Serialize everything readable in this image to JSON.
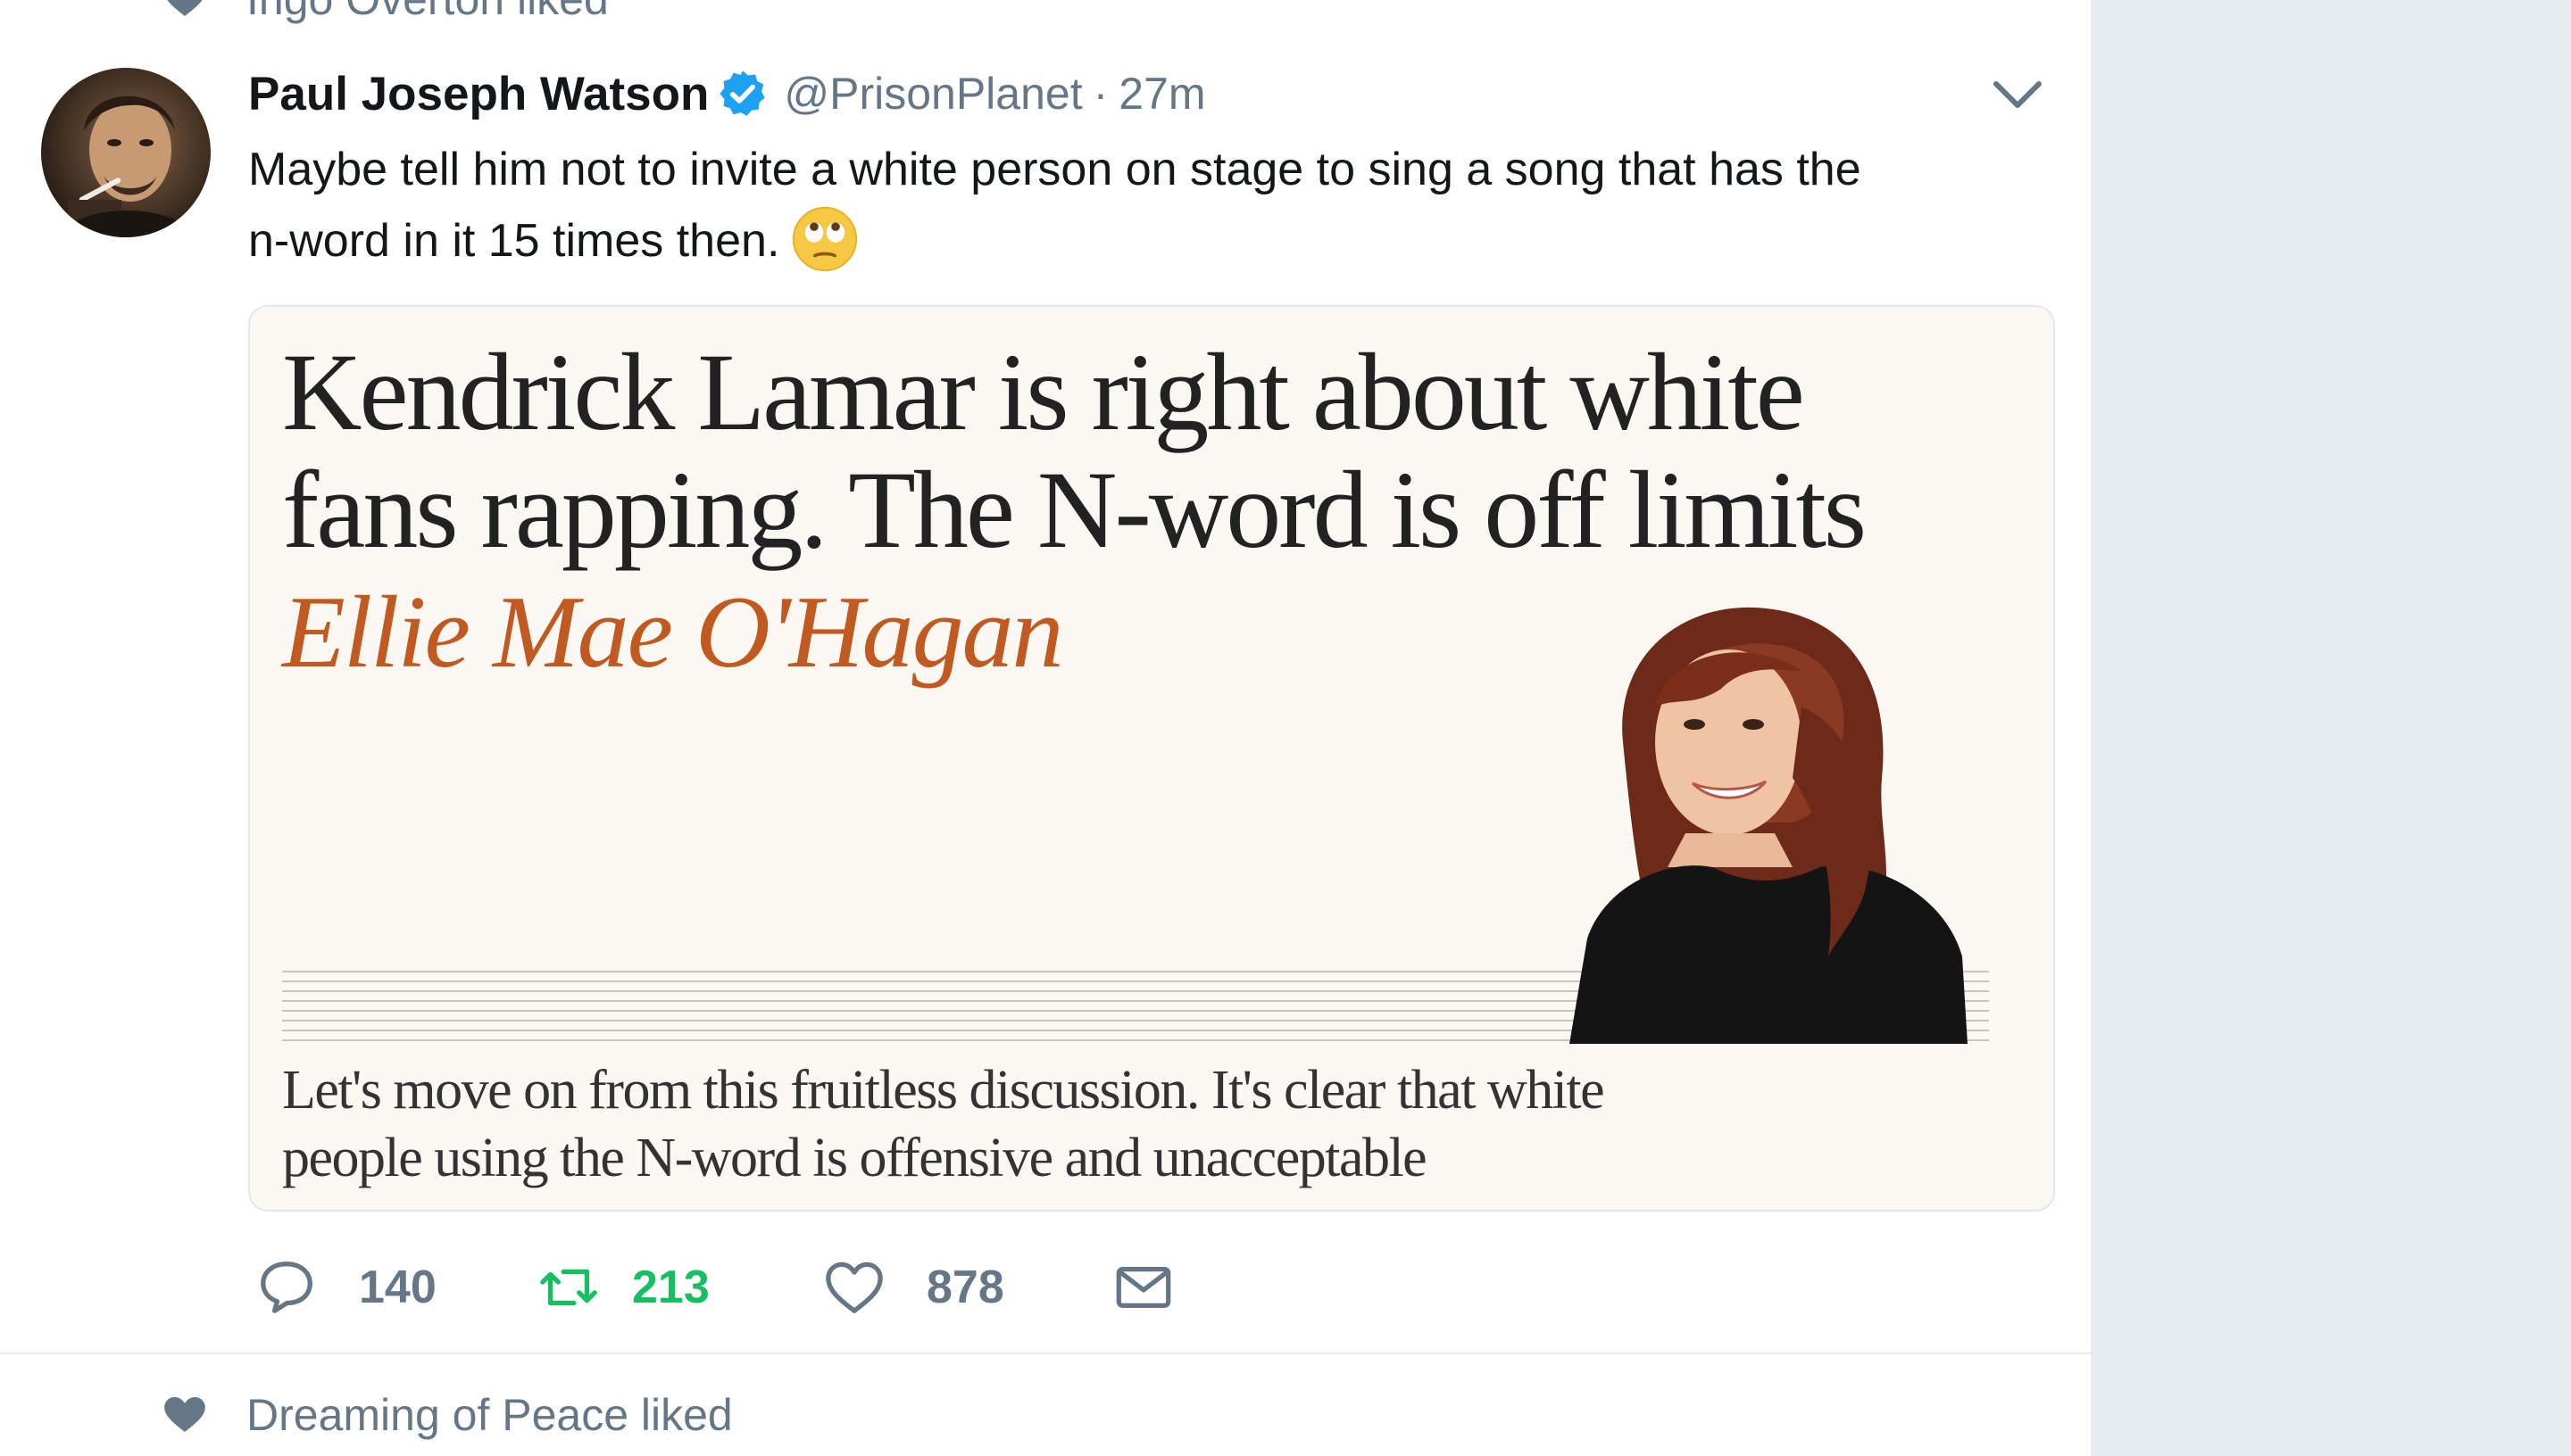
{
  "context_top": {
    "text": "Ingo Overton liked",
    "icon": "heart-icon"
  },
  "tweet": {
    "author_name": "Paul Joseph Watson",
    "verified": true,
    "handle": "@PrisonPlanet",
    "separator": "·",
    "time": "27m",
    "text_line1": "Maybe tell him not to invite a white person on stage to sing a song that has the",
    "text_line2": "n-word in it 15 times then.",
    "emoji": "face-with-rolling-eyes"
  },
  "card": {
    "headline_line1": "Kendrick Lamar is right about white",
    "headline_line2": "fans rapping. The N-word is off limits",
    "author": "Ellie Mae O'Hagan",
    "standfirst_line1": "Let's move on from this fruitless discussion. It's clear that white",
    "standfirst_line2": "people using the N-word is offensive and unacceptable"
  },
  "actions": {
    "reply_count": "140",
    "retweet_count": "213",
    "like_count": "878",
    "retweet_color": "#17bf63",
    "icon_color": "#657786"
  },
  "context_bottom": {
    "text": "Dreaming of Peace liked",
    "icon": "heart-icon"
  },
  "colors": {
    "verified_blue": "#1da1f2",
    "secondary_text": "#657786",
    "author_accent": "#c05a20",
    "sidebar_bg": "#e6ecf0"
  }
}
